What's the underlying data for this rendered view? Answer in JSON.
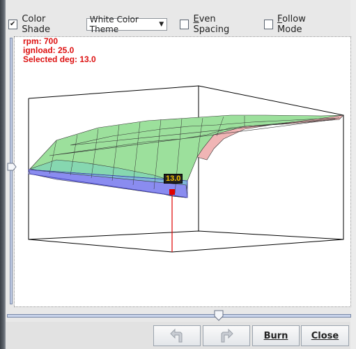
{
  "toolbar": {
    "color_shade": {
      "label": "Color Shade",
      "checked": true
    },
    "theme_select": {
      "value": "White Color Theme"
    },
    "even_spacing": {
      "label": "Even Spacing",
      "checked": false
    },
    "follow_mode": {
      "label": "Follow Mode",
      "checked": false
    }
  },
  "info": {
    "rpm": "rpm: 700",
    "ignload": "ignload: 25.0",
    "selected": "Selected deg: 13.0"
  },
  "tooltip": {
    "value": "13.0"
  },
  "buttons": {
    "undo_icon": "undo-icon",
    "redo_icon": "redo-icon",
    "burn": "Burn",
    "close": "Close"
  },
  "colors": {
    "info_text": "#dd1111",
    "marker": "#e00000",
    "surface_low": "#8a8cf0",
    "surface_mid": "#90e0a0",
    "surface_high": "#f0b0b0"
  }
}
